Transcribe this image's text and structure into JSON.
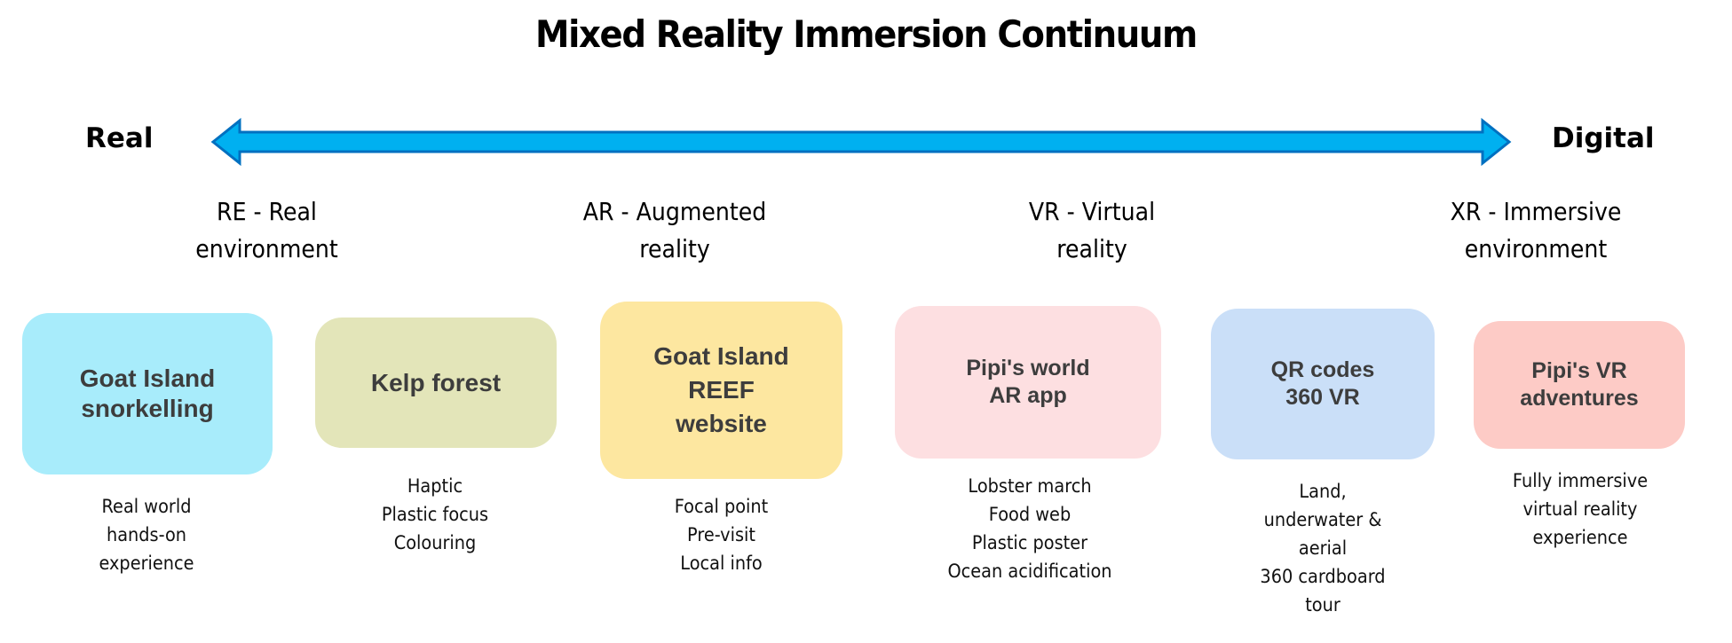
{
  "title": "Mixed Reality Immersion Continuum",
  "axis": {
    "left_label": "Real",
    "right_label": "Digital",
    "arrow_icon": "double-headed-arrow",
    "arrow_fill": "#00b0f0",
    "arrow_stroke": "#0070c0"
  },
  "categories": [
    {
      "id": "re",
      "label": "RE - Real\nenvironment"
    },
    {
      "id": "ar",
      "label": "AR - Augmented\nreality"
    },
    {
      "id": "vr",
      "label": "VR - Virtual\nreality"
    },
    {
      "id": "xr",
      "label": "XR - Immersive\nenvironment"
    }
  ],
  "items": [
    {
      "title": "Goat Island\nsnorkelling",
      "color": "#a8ecfb",
      "description": "Real world\nhands-on\nexperience"
    },
    {
      "title": "Kelp forest",
      "color": "#e3e5b9",
      "description": "Haptic\nPlastic focus\nColouring"
    },
    {
      "title": "Goat Island\nREEF\nwebsite",
      "color": "#fde7a0",
      "description": "Focal point\nPre-visit\nLocal info"
    },
    {
      "title": "Pipi's world\nAR app",
      "color": "#fddfe1",
      "description": "Lobster march\nFood web\nPlastic poster\nOcean acidification"
    },
    {
      "title": "QR codes\n360 VR",
      "color": "#cadff8",
      "description": "Land,\nunderwater &\naerial\n360 cardboard\ntour"
    },
    {
      "title": "Pipi's VR\nadventures",
      "color": "#fdcbc6",
      "description": "Fully immersive\nvirtual reality\nexperience"
    }
  ]
}
